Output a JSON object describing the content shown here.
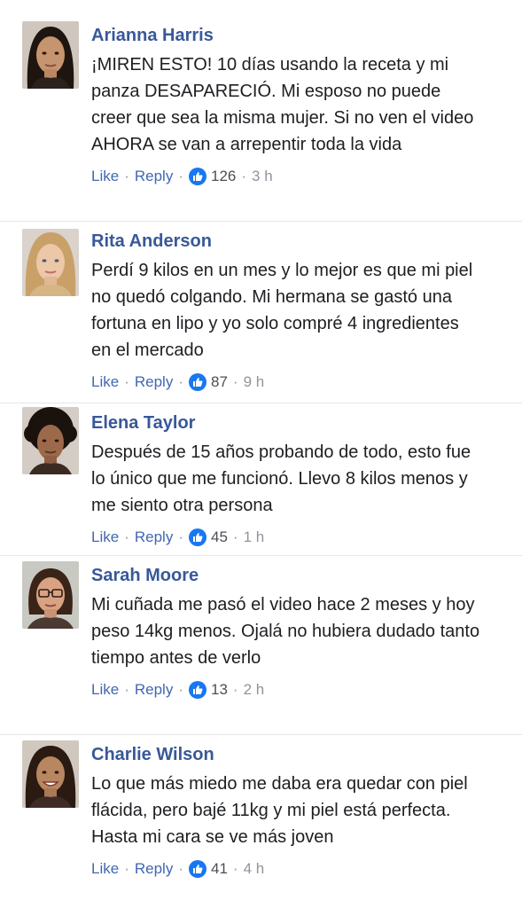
{
  "comments": [
    {
      "name": "Arianna Harris",
      "text": "¡MIREN ESTO! 10 días usando la receta y mi panza DESAPARECIÓ. Mi esposo no puede creer que sea la misma mujer. Si no ven el video AHORA se van a arrepentir toda la vida",
      "like_label": "Like",
      "reply_label": "Reply",
      "likes": "126",
      "time": "3 h"
    },
    {
      "name": "Rita Anderson",
      "text": "Perdí 9 kilos en un mes y lo mejor es que mi piel no quedó colgando. Mi hermana se gastó una fortuna en lipo y yo solo compré 4 ingredientes en el mercado",
      "like_label": "Like",
      "reply_label": "Reply",
      "likes": "87",
      "time": "9 h"
    },
    {
      "name": "Elena Taylor",
      "text": "Después de 15 años probando de todo, esto fue lo único que me funcionó. Llevo 8 kilos menos y me siento otra persona",
      "like_label": "Like",
      "reply_label": "Reply",
      "likes": "45",
      "time": "1 h"
    },
    {
      "name": "Sarah Moore",
      "text": "Mi cuñada me pasó el video hace 2 meses y hoy peso 14kg menos. Ojalá no hubiera dudado tanto tiempo antes de verlo",
      "like_label": "Like",
      "reply_label": "Reply",
      "likes": "13",
      "time": "2 h"
    },
    {
      "name": "Charlie Wilson",
      "text": "Lo que más miedo me daba era quedar con piel flácida, pero bajé 11kg y mi piel está perfecta. Hasta mi cara se ve más joven",
      "like_label": "Like",
      "reply_label": "Reply",
      "likes": "41",
      "time": "4 h"
    }
  ],
  "colors": {
    "name": "#385898",
    "link": "#4267b2",
    "like_badge": "#1877f2",
    "meta": "#90949c"
  },
  "icons": {
    "reaction": "thumbs-up-icon"
  }
}
